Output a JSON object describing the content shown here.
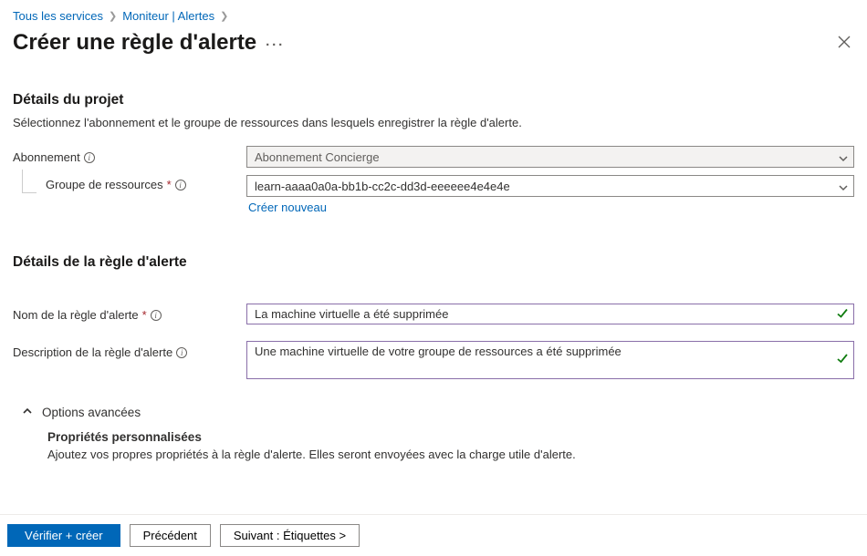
{
  "breadcrumb": {
    "all_services": "Tous les services",
    "monitor_alerts": "Moniteur | Alertes"
  },
  "page_title": "Créer une règle d'alerte",
  "project": {
    "heading": "Détails du projet",
    "subtext": "Sélectionnez l'abonnement et le groupe de ressources dans lesquels enregistrer la règle d'alerte.",
    "subscription_label": "Abonnement",
    "subscription_value": "Abonnement Concierge",
    "rg_label": "Groupe de ressources",
    "rg_value": "learn-aaaa0a0a-bb1b-cc2c-dd3d-eeeeee4e4e4e",
    "create_new": "Créer nouveau"
  },
  "rule": {
    "heading": "Détails de la règle d'alerte",
    "name_label": "Nom de la règle d'alerte",
    "name_value": "La machine virtuelle a été supprimée",
    "desc_label": "Description de la règle d'alerte",
    "desc_value": "Une machine virtuelle de votre groupe de ressources a été supprimée"
  },
  "advanced": {
    "header": "Options avancées",
    "sub_heading": "Propriétés personnalisées",
    "sub_desc": "Ajoutez vos propres propriétés à la règle d'alerte. Elles seront envoyées avec la charge utile d'alerte."
  },
  "footer": {
    "review": "Vérifier + créer",
    "prev": "Précédent",
    "next": "Suivant :  Étiquettes >"
  }
}
